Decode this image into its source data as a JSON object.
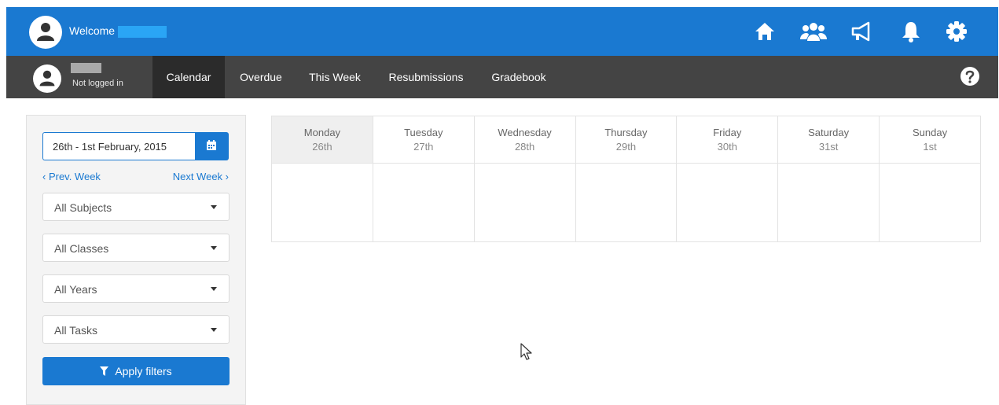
{
  "header": {
    "welcome_label": "Welcome",
    "icons": [
      "home-icon",
      "users-icon",
      "megaphone-icon",
      "bell-icon",
      "gear-icon"
    ]
  },
  "nav": {
    "user_status": "Not logged in",
    "tabs": [
      {
        "label": "Calendar",
        "active": true
      },
      {
        "label": "Overdue",
        "active": false
      },
      {
        "label": "This Week",
        "active": false
      },
      {
        "label": "Resubmissions",
        "active": false
      },
      {
        "label": "Gradebook",
        "active": false
      }
    ],
    "help_icon": "question-circle-icon"
  },
  "sidebar": {
    "date_range": "26th - 1st February, 2015",
    "prev_week": "‹ Prev. Week",
    "next_week": "Next Week ›",
    "filters": [
      {
        "name": "subjects",
        "selected": "All Subjects"
      },
      {
        "name": "classes",
        "selected": "All Classes"
      },
      {
        "name": "years",
        "selected": "All Years"
      },
      {
        "name": "tasks",
        "selected": "All Tasks"
      }
    ],
    "apply_label": "Apply filters"
  },
  "calendar": {
    "days": [
      {
        "name": "Monday",
        "date": "26th",
        "today": true
      },
      {
        "name": "Tuesday",
        "date": "27th",
        "today": false
      },
      {
        "name": "Wednesday",
        "date": "28th",
        "today": false
      },
      {
        "name": "Thursday",
        "date": "29th",
        "today": false
      },
      {
        "name": "Friday",
        "date": "30th",
        "today": false
      },
      {
        "name": "Saturday",
        "date": "31st",
        "today": false
      },
      {
        "name": "Sunday",
        "date": "1st",
        "today": false
      }
    ]
  },
  "colors": {
    "primary": "#1a79d1",
    "nav_bg": "#444444",
    "nav_active": "#2b2b2b",
    "sidebar_bg": "#f4f4f4"
  }
}
